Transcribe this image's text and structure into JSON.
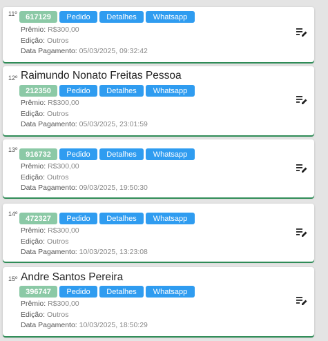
{
  "labels": {
    "premio": "Prêmio:",
    "edicao": "Edição:",
    "data_pagamento": "Data Pagamento:",
    "pedido": "Pedido",
    "detalhes": "Detalhes",
    "whatsapp": "Whatsapp"
  },
  "entries": [
    {
      "rank": "11º",
      "name": "",
      "code": "617129",
      "premio": "R$300,00",
      "edicao": "Outros",
      "data": "05/03/2025, 09:32:42"
    },
    {
      "rank": "12º",
      "name": "Raimundo Nonato Freitas Pessoa",
      "code": "212350",
      "premio": "R$300,00",
      "edicao": "Outros",
      "data": "05/03/2025, 23:01:59"
    },
    {
      "rank": "13º",
      "name": "",
      "code": "916732",
      "premio": "R$300,00",
      "edicao": "Outros",
      "data": "09/03/2025, 19:50:30"
    },
    {
      "rank": "14º",
      "name": "",
      "code": "472327",
      "premio": "R$300,00",
      "edicao": "Outros",
      "data": "10/03/2025, 13:23:08"
    },
    {
      "rank": "15º",
      "name": "Andre Santos Pereira",
      "code": "396747",
      "premio": "R$300,00",
      "edicao": "Outros",
      "data": "10/03/2025, 18:50:29"
    }
  ],
  "colors": {
    "badge": "#8bc9a6",
    "button": "#2f9cf0",
    "card_accent": "#2f8c57"
  },
  "icons": {
    "edit": "edit-note-icon"
  }
}
